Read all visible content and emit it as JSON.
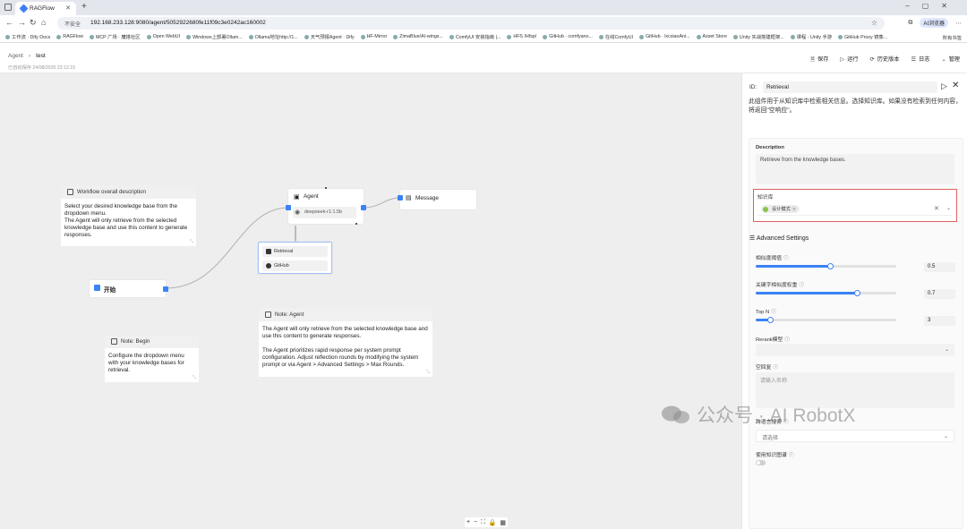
{
  "browser": {
    "tab_title": "RAGFlow",
    "url_security": "不安全",
    "url": "192.168.233.128:9080/agent/5052922680fe11f09c3e0242ac160002",
    "profile": "AI浏览器",
    "bookmarks": [
      "工作流 · Dify Docs",
      "RAGFlow",
      "MCP 广场 · 魔搭社区",
      "Open WebUI",
      "Windows上部署Ollam...",
      "Ollama地址http://1...",
      "天气预报Agent · Dify",
      "HF-Mirror",
      "ZimaBlue/AI-wings...",
      "ComfyUI 安装指南 |...",
      "HFS /Hfsp/",
      "GitHub · comfyano...",
      "在线ComfyUI",
      "GitHub · lxcxiaoAni...",
      "Asset Store",
      "Unity 实战搭建框架...",
      "课程 - Unity 手游",
      "GitHub Proxy 镜像..."
    ],
    "bookmarks_all": "所有书签"
  },
  "header": {
    "breadcrumb_root": "Agent",
    "breadcrumb_current": "test",
    "saved_text": "已自动保存 24/08/2025 23:12:15",
    "actions": [
      {
        "icon": "save-icon",
        "glyph": "🗎",
        "label": "保存"
      },
      {
        "icon": "run-icon",
        "glyph": "▷",
        "label": "运行"
      },
      {
        "icon": "history-icon",
        "glyph": "⟳",
        "label": "历史版本"
      },
      {
        "icon": "log-icon",
        "glyph": "☰",
        "label": "日志"
      },
      {
        "icon": "manage-icon",
        "glyph": "⌄",
        "label": "管理"
      }
    ]
  },
  "canvas": {
    "workflow_note_title": "Workflow overall description",
    "workflow_note_body": "Select your desired knowledge base from the dropdown menu.\nThe Agent will only retrieve from the selected knowledge base and use this content to generate responses.",
    "agent_title": "Agent",
    "agent_model": "deepseek-r1:1.5b",
    "message_title": "Message",
    "begin_title": "开始",
    "tools": [
      "Retrieval",
      "GitHub"
    ],
    "agent_note_title": "Note: Agent",
    "agent_note_body": "The Agent will only retrieve from the selected knowledge base and use this content to generate responses.\n\nThe Agent prioritizes rapid response per system prompt configuration. Adjust reflection rounds by modifying the system prompt or via Agent > Advanced Settings > Max Rounds.",
    "begin_note_title": "Note: Begin",
    "begin_note_body": "Configure the dropdown menu with your knowledge bases for retrieval.",
    "zoom_controls": [
      "+",
      "−",
      "⛶",
      "🔒",
      "▦"
    ]
  },
  "panel": {
    "id_label": "ID:",
    "id_value": "Retrieval",
    "description_text": "此组件用于从知识库中检索相关信息。选择知识库。如果没有检索到任何内容，将返回\"空响应\"。",
    "description_label": "Description",
    "description_value": "Retrieve from the knowledge bases.",
    "kb_label": "知识库",
    "kb_tag": "设计模式",
    "advanced_label": "Advanced Settings",
    "similarity_label": "相似度阈值",
    "similarity_value": "0.5",
    "similarity_fraction": 0.5,
    "keyword_label": "关键字相似度权重",
    "keyword_value": "0.7",
    "keyword_fraction": 0.7,
    "topn_label": "Top N",
    "topn_value": "3",
    "topn_fraction": 0.1,
    "rerank_label": "Rerank模型",
    "empty_label": "空回复",
    "empty_placeholder": "请输入名称",
    "cross_lang_label": "跨语言搜索",
    "cross_lang_placeholder": "请选择",
    "kg_label": "使用知识图谱"
  },
  "watermark": {
    "text": "公众号 · AI RobotX"
  },
  "colors": {
    "accent": "#3b82f6",
    "kb_highlight": "#e06060"
  }
}
